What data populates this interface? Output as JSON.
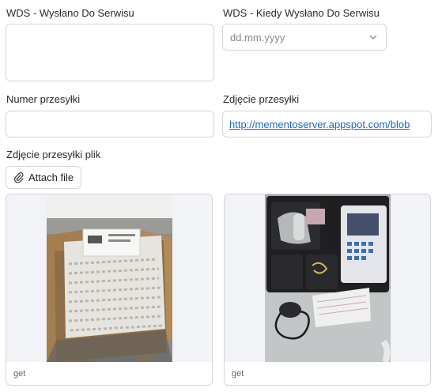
{
  "fields": {
    "wds": {
      "label": "WDS - Wysłano Do Serwisu",
      "value": ""
    },
    "wds_date": {
      "label": "WDS - Kiedy Wysłano Do Serwisu",
      "placeholder": "dd.mm.yyyy"
    },
    "tracking_number": {
      "label": "Numer przesyłki",
      "value": ""
    },
    "shipment_photo_url": {
      "label": "Zdjęcie przesyłki",
      "link_text": "http://mementoserver.appspot.com/blob"
    },
    "shipment_photo_file": {
      "label": "Zdjęcie przesyłki plik",
      "attach_label": "Attach file"
    }
  },
  "attachments": [
    {
      "caption": "get",
      "image": "photo of an opened cardboard box packed with paper packing material and a shipping label"
    },
    {
      "caption": "get",
      "image": "photo of an opened black case holding a handheld device with keypad and screen, a probe and cables"
    }
  ],
  "icons": {
    "date_dropdown": "chevron-down-icon",
    "attach": "paperclip-icon"
  },
  "colors": {
    "link": "#1a66c7",
    "border": "#d4d6da",
    "image_background": "#f1f3f7"
  }
}
